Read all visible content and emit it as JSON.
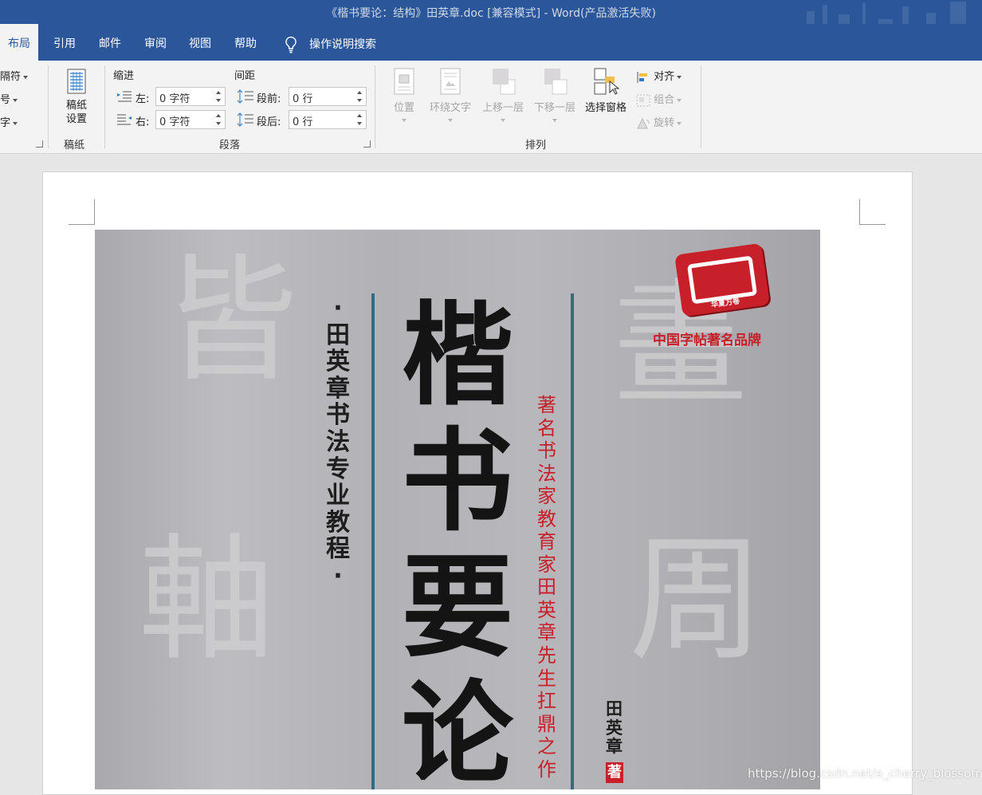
{
  "window": {
    "title": "《楷书要论：结构》田英章.doc [兼容模式]  -  Word(产品激活失败)"
  },
  "tabs": [
    "布局",
    "引用",
    "邮件",
    "审阅",
    "视图",
    "帮助"
  ],
  "tell_me": "操作说明搜索",
  "ribbon": {
    "page_setup_partial": {
      "breaks": "隔符",
      "line_numbers": "号",
      "hyphenation": "字"
    },
    "manuscript": {
      "button": "稿纸设置",
      "group_label": "稿纸"
    },
    "paragraph": {
      "indent_header": "缩进",
      "spacing_header": "间距",
      "left_label": "左:",
      "left_value": "0 字符",
      "right_label": "右:",
      "right_value": "0 字符",
      "before_label": "段前:",
      "before_value": "0 行",
      "after_label": "段后:",
      "after_value": "0 行",
      "group_label": "段落"
    },
    "arrange": {
      "position": "位置",
      "wrap_text": "环绕文字",
      "bring_forward": "上移一层",
      "send_backward": "下移一层",
      "selection_pane": "选择窗格",
      "align": "对齐",
      "group": "组合",
      "rotate": "旋转",
      "group_label": "排列"
    }
  },
  "cover": {
    "title": "楷书要论",
    "series": "·田英章书法专业教程·",
    "subtitle": "著名书法家教育家田英章先生扛鼎之作",
    "author": "田英章",
    "author_stamp": "著",
    "brand": "中国字帖著名品牌",
    "logo_text": "华夏万卷",
    "bg_chars": [
      "皆",
      "軸",
      "畫",
      "周"
    ]
  },
  "watermark": "https://blog.csdn.net/a_cherry_blossoms",
  "colors": {
    "title_bar": "#2b579a",
    "ribbon": "#f3f3f3",
    "accent_red": "#c8202a",
    "cover_line": "#2f6e82"
  }
}
